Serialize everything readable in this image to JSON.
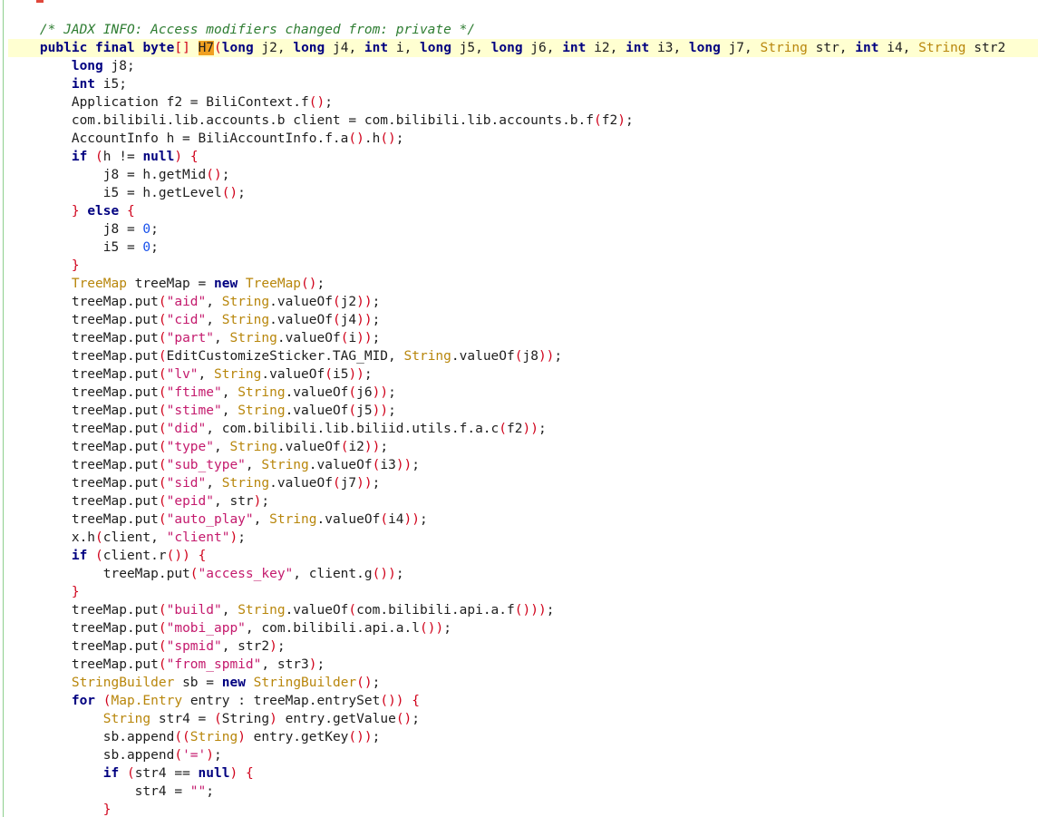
{
  "editor": {
    "current_line": 1,
    "lines": [
      [
        {
          "t": "    "
        },
        {
          "t": "/* JADX INFO: Access modifiers changed from: private */",
          "c": "comment"
        }
      ],
      [
        {
          "t": "    "
        },
        {
          "t": "public",
          "c": "keyword"
        },
        {
          "t": " "
        },
        {
          "t": "final",
          "c": "keyword"
        },
        {
          "t": " "
        },
        {
          "t": "byte",
          "c": "keyword"
        },
        {
          "t": "[]",
          "c": "bracket"
        },
        {
          "t": " "
        },
        {
          "t": "H7",
          "c": "caret"
        },
        {
          "t": "(",
          "c": "bracket"
        },
        {
          "t": "long",
          "c": "keyword"
        },
        {
          "t": " j2, "
        },
        {
          "t": "long",
          "c": "keyword"
        },
        {
          "t": " j4, "
        },
        {
          "t": "int",
          "c": "keyword"
        },
        {
          "t": " i, "
        },
        {
          "t": "long",
          "c": "keyword"
        },
        {
          "t": " j5, "
        },
        {
          "t": "long",
          "c": "keyword"
        },
        {
          "t": " j6, "
        },
        {
          "t": "int",
          "c": "keyword"
        },
        {
          "t": " i2, "
        },
        {
          "t": "int",
          "c": "keyword"
        },
        {
          "t": " i3, "
        },
        {
          "t": "long",
          "c": "keyword"
        },
        {
          "t": " j7, "
        },
        {
          "t": "String",
          "c": "type"
        },
        {
          "t": " str, "
        },
        {
          "t": "int",
          "c": "keyword"
        },
        {
          "t": " i4, "
        },
        {
          "t": "String",
          "c": "type"
        },
        {
          "t": " str2"
        }
      ],
      [
        {
          "t": "        "
        },
        {
          "t": "long",
          "c": "keyword"
        },
        {
          "t": " j8;"
        }
      ],
      [
        {
          "t": "        "
        },
        {
          "t": "int",
          "c": "keyword"
        },
        {
          "t": " i5;"
        }
      ],
      [
        {
          "t": "        Application f2 = BiliContext.f"
        },
        {
          "t": "()",
          "c": "bracket"
        },
        {
          "t": ";"
        }
      ],
      [
        {
          "t": "        com.bilibili.lib.accounts.b client = com.bilibili.lib.accounts.b.f"
        },
        {
          "t": "(",
          "c": "bracket"
        },
        {
          "t": "f2"
        },
        {
          "t": ")",
          "c": "bracket"
        },
        {
          "t": ";"
        }
      ],
      [
        {
          "t": "        AccountInfo h = BiliAccountInfo.f.a"
        },
        {
          "t": "()",
          "c": "bracket"
        },
        {
          "t": ".h"
        },
        {
          "t": "()",
          "c": "bracket"
        },
        {
          "t": ";"
        }
      ],
      [
        {
          "t": "        "
        },
        {
          "t": "if",
          "c": "keyword"
        },
        {
          "t": " "
        },
        {
          "t": "(",
          "c": "bracket"
        },
        {
          "t": "h != "
        },
        {
          "t": "null",
          "c": "keyword"
        },
        {
          "t": ")",
          "c": "bracket"
        },
        {
          "t": " "
        },
        {
          "t": "{",
          "c": "bracket"
        }
      ],
      [
        {
          "t": "            j8 = h.getMid"
        },
        {
          "t": "()",
          "c": "bracket"
        },
        {
          "t": ";"
        }
      ],
      [
        {
          "t": "            i5 = h.getLevel"
        },
        {
          "t": "()",
          "c": "bracket"
        },
        {
          "t": ";"
        }
      ],
      [
        {
          "t": "        "
        },
        {
          "t": "}",
          "c": "bracket"
        },
        {
          "t": " "
        },
        {
          "t": "else",
          "c": "keyword"
        },
        {
          "t": " "
        },
        {
          "t": "{",
          "c": "bracket"
        }
      ],
      [
        {
          "t": "            j8 = "
        },
        {
          "t": "0",
          "c": "number"
        },
        {
          "t": ";"
        }
      ],
      [
        {
          "t": "            i5 = "
        },
        {
          "t": "0",
          "c": "number"
        },
        {
          "t": ";"
        }
      ],
      [
        {
          "t": "        "
        },
        {
          "t": "}",
          "c": "bracket"
        }
      ],
      [
        {
          "t": "        "
        },
        {
          "t": "TreeMap",
          "c": "type"
        },
        {
          "t": " treeMap = "
        },
        {
          "t": "new",
          "c": "keyword"
        },
        {
          "t": " "
        },
        {
          "t": "TreeMap",
          "c": "type"
        },
        {
          "t": "()",
          "c": "bracket"
        },
        {
          "t": ";"
        }
      ],
      [
        {
          "t": "        treeMap.put"
        },
        {
          "t": "(",
          "c": "bracket"
        },
        {
          "t": "\"aid\"",
          "c": "string"
        },
        {
          "t": ", "
        },
        {
          "t": "String",
          "c": "type"
        },
        {
          "t": ".valueOf"
        },
        {
          "t": "(",
          "c": "bracket"
        },
        {
          "t": "j2"
        },
        {
          "t": "))",
          "c": "bracket"
        },
        {
          "t": ";"
        }
      ],
      [
        {
          "t": "        treeMap.put"
        },
        {
          "t": "(",
          "c": "bracket"
        },
        {
          "t": "\"cid\"",
          "c": "string"
        },
        {
          "t": ", "
        },
        {
          "t": "String",
          "c": "type"
        },
        {
          "t": ".valueOf"
        },
        {
          "t": "(",
          "c": "bracket"
        },
        {
          "t": "j4"
        },
        {
          "t": "))",
          "c": "bracket"
        },
        {
          "t": ";"
        }
      ],
      [
        {
          "t": "        treeMap.put"
        },
        {
          "t": "(",
          "c": "bracket"
        },
        {
          "t": "\"part\"",
          "c": "string"
        },
        {
          "t": ", "
        },
        {
          "t": "String",
          "c": "type"
        },
        {
          "t": ".valueOf"
        },
        {
          "t": "(",
          "c": "bracket"
        },
        {
          "t": "i"
        },
        {
          "t": "))",
          "c": "bracket"
        },
        {
          "t": ";"
        }
      ],
      [
        {
          "t": "        treeMap.put"
        },
        {
          "t": "(",
          "c": "bracket"
        },
        {
          "t": "EditCustomizeSticker.TAG_MID, "
        },
        {
          "t": "String",
          "c": "type"
        },
        {
          "t": ".valueOf"
        },
        {
          "t": "(",
          "c": "bracket"
        },
        {
          "t": "j8"
        },
        {
          "t": "))",
          "c": "bracket"
        },
        {
          "t": ";"
        }
      ],
      [
        {
          "t": "        treeMap.put"
        },
        {
          "t": "(",
          "c": "bracket"
        },
        {
          "t": "\"lv\"",
          "c": "string"
        },
        {
          "t": ", "
        },
        {
          "t": "String",
          "c": "type"
        },
        {
          "t": ".valueOf"
        },
        {
          "t": "(",
          "c": "bracket"
        },
        {
          "t": "i5"
        },
        {
          "t": "))",
          "c": "bracket"
        },
        {
          "t": ";"
        }
      ],
      [
        {
          "t": "        treeMap.put"
        },
        {
          "t": "(",
          "c": "bracket"
        },
        {
          "t": "\"ftime\"",
          "c": "string"
        },
        {
          "t": ", "
        },
        {
          "t": "String",
          "c": "type"
        },
        {
          "t": ".valueOf"
        },
        {
          "t": "(",
          "c": "bracket"
        },
        {
          "t": "j6"
        },
        {
          "t": "))",
          "c": "bracket"
        },
        {
          "t": ";"
        }
      ],
      [
        {
          "t": "        treeMap.put"
        },
        {
          "t": "(",
          "c": "bracket"
        },
        {
          "t": "\"stime\"",
          "c": "string"
        },
        {
          "t": ", "
        },
        {
          "t": "String",
          "c": "type"
        },
        {
          "t": ".valueOf"
        },
        {
          "t": "(",
          "c": "bracket"
        },
        {
          "t": "j5"
        },
        {
          "t": "))",
          "c": "bracket"
        },
        {
          "t": ";"
        }
      ],
      [
        {
          "t": "        treeMap.put"
        },
        {
          "t": "(",
          "c": "bracket"
        },
        {
          "t": "\"did\"",
          "c": "string"
        },
        {
          "t": ", com.bilibili.lib.biliid.utils.f.a.c"
        },
        {
          "t": "(",
          "c": "bracket"
        },
        {
          "t": "f2"
        },
        {
          "t": "))",
          "c": "bracket"
        },
        {
          "t": ";"
        }
      ],
      [
        {
          "t": "        treeMap.put"
        },
        {
          "t": "(",
          "c": "bracket"
        },
        {
          "t": "\"type\"",
          "c": "string"
        },
        {
          "t": ", "
        },
        {
          "t": "String",
          "c": "type"
        },
        {
          "t": ".valueOf"
        },
        {
          "t": "(",
          "c": "bracket"
        },
        {
          "t": "i2"
        },
        {
          "t": "))",
          "c": "bracket"
        },
        {
          "t": ";"
        }
      ],
      [
        {
          "t": "        treeMap.put"
        },
        {
          "t": "(",
          "c": "bracket"
        },
        {
          "t": "\"sub_type\"",
          "c": "string"
        },
        {
          "t": ", "
        },
        {
          "t": "String",
          "c": "type"
        },
        {
          "t": ".valueOf"
        },
        {
          "t": "(",
          "c": "bracket"
        },
        {
          "t": "i3"
        },
        {
          "t": "))",
          "c": "bracket"
        },
        {
          "t": ";"
        }
      ],
      [
        {
          "t": "        treeMap.put"
        },
        {
          "t": "(",
          "c": "bracket"
        },
        {
          "t": "\"sid\"",
          "c": "string"
        },
        {
          "t": ", "
        },
        {
          "t": "String",
          "c": "type"
        },
        {
          "t": ".valueOf"
        },
        {
          "t": "(",
          "c": "bracket"
        },
        {
          "t": "j7"
        },
        {
          "t": "))",
          "c": "bracket"
        },
        {
          "t": ";"
        }
      ],
      [
        {
          "t": "        treeMap.put"
        },
        {
          "t": "(",
          "c": "bracket"
        },
        {
          "t": "\"epid\"",
          "c": "string"
        },
        {
          "t": ", str"
        },
        {
          "t": ")",
          "c": "bracket"
        },
        {
          "t": ";"
        }
      ],
      [
        {
          "t": "        treeMap.put"
        },
        {
          "t": "(",
          "c": "bracket"
        },
        {
          "t": "\"auto_play\"",
          "c": "string"
        },
        {
          "t": ", "
        },
        {
          "t": "String",
          "c": "type"
        },
        {
          "t": ".valueOf"
        },
        {
          "t": "(",
          "c": "bracket"
        },
        {
          "t": "i4"
        },
        {
          "t": "))",
          "c": "bracket"
        },
        {
          "t": ";"
        }
      ],
      [
        {
          "t": "        x.h"
        },
        {
          "t": "(",
          "c": "bracket"
        },
        {
          "t": "client, "
        },
        {
          "t": "\"client\"",
          "c": "string"
        },
        {
          "t": ")",
          "c": "bracket"
        },
        {
          "t": ";"
        }
      ],
      [
        {
          "t": "        "
        },
        {
          "t": "if",
          "c": "keyword"
        },
        {
          "t": " "
        },
        {
          "t": "(",
          "c": "bracket"
        },
        {
          "t": "client.r"
        },
        {
          "t": "())",
          "c": "bracket"
        },
        {
          "t": " "
        },
        {
          "t": "{",
          "c": "bracket"
        }
      ],
      [
        {
          "t": "            treeMap.put"
        },
        {
          "t": "(",
          "c": "bracket"
        },
        {
          "t": "\"access_key\"",
          "c": "string"
        },
        {
          "t": ", client.g"
        },
        {
          "t": "())",
          "c": "bracket"
        },
        {
          "t": ";"
        }
      ],
      [
        {
          "t": "        "
        },
        {
          "t": "}",
          "c": "bracket"
        }
      ],
      [
        {
          "t": "        treeMap.put"
        },
        {
          "t": "(",
          "c": "bracket"
        },
        {
          "t": "\"build\"",
          "c": "string"
        },
        {
          "t": ", "
        },
        {
          "t": "String",
          "c": "type"
        },
        {
          "t": ".valueOf"
        },
        {
          "t": "(",
          "c": "bracket"
        },
        {
          "t": "com.bilibili.api.a.f"
        },
        {
          "t": "()))",
          "c": "bracket"
        },
        {
          "t": ";"
        }
      ],
      [
        {
          "t": "        treeMap.put"
        },
        {
          "t": "(",
          "c": "bracket"
        },
        {
          "t": "\"mobi_app\"",
          "c": "string"
        },
        {
          "t": ", com.bilibili.api.a.l"
        },
        {
          "t": "())",
          "c": "bracket"
        },
        {
          "t": ";"
        }
      ],
      [
        {
          "t": "        treeMap.put"
        },
        {
          "t": "(",
          "c": "bracket"
        },
        {
          "t": "\"spmid\"",
          "c": "string"
        },
        {
          "t": ", str2"
        },
        {
          "t": ")",
          "c": "bracket"
        },
        {
          "t": ";"
        }
      ],
      [
        {
          "t": "        treeMap.put"
        },
        {
          "t": "(",
          "c": "bracket"
        },
        {
          "t": "\"from_spmid\"",
          "c": "string"
        },
        {
          "t": ", str3"
        },
        {
          "t": ")",
          "c": "bracket"
        },
        {
          "t": ";"
        }
      ],
      [
        {
          "t": "        "
        },
        {
          "t": "StringBuilder",
          "c": "type"
        },
        {
          "t": " sb = "
        },
        {
          "t": "new",
          "c": "keyword"
        },
        {
          "t": " "
        },
        {
          "t": "StringBuilder",
          "c": "type"
        },
        {
          "t": "()",
          "c": "bracket"
        },
        {
          "t": ";"
        }
      ],
      [
        {
          "t": "        "
        },
        {
          "t": "for",
          "c": "keyword"
        },
        {
          "t": " "
        },
        {
          "t": "(",
          "c": "bracket"
        },
        {
          "t": "Map.Entry",
          "c": "type"
        },
        {
          "t": " entry : treeMap.entrySet"
        },
        {
          "t": "())",
          "c": "bracket"
        },
        {
          "t": " "
        },
        {
          "t": "{",
          "c": "bracket"
        }
      ],
      [
        {
          "t": "            "
        },
        {
          "t": "String",
          "c": "type"
        },
        {
          "t": " str4 = "
        },
        {
          "t": "(",
          "c": "bracket"
        },
        {
          "t": "String"
        },
        {
          "t": ")",
          "c": "bracket"
        },
        {
          "t": " entry.getValue"
        },
        {
          "t": "()",
          "c": "bracket"
        },
        {
          "t": ";"
        }
      ],
      [
        {
          "t": "            sb.append"
        },
        {
          "t": "((",
          "c": "bracket"
        },
        {
          "t": "String",
          "c": "type"
        },
        {
          "t": ")",
          "c": "bracket"
        },
        {
          "t": " entry.getKey"
        },
        {
          "t": "())",
          "c": "bracket"
        },
        {
          "t": ";"
        }
      ],
      [
        {
          "t": "            sb.append"
        },
        {
          "t": "(",
          "c": "bracket"
        },
        {
          "t": "'='",
          "c": "string"
        },
        {
          "t": ")",
          "c": "bracket"
        },
        {
          "t": ";"
        }
      ],
      [
        {
          "t": "            "
        },
        {
          "t": "if",
          "c": "keyword"
        },
        {
          "t": " "
        },
        {
          "t": "(",
          "c": "bracket"
        },
        {
          "t": "str4 == "
        },
        {
          "t": "null",
          "c": "keyword"
        },
        {
          "t": ")",
          "c": "bracket"
        },
        {
          "t": " "
        },
        {
          "t": "{",
          "c": "bracket"
        }
      ],
      [
        {
          "t": "                str4 = "
        },
        {
          "t": "\"\"",
          "c": "string"
        },
        {
          "t": ";"
        }
      ],
      [
        {
          "t": "            "
        },
        {
          "t": "}",
          "c": "bracket"
        }
      ]
    ]
  }
}
